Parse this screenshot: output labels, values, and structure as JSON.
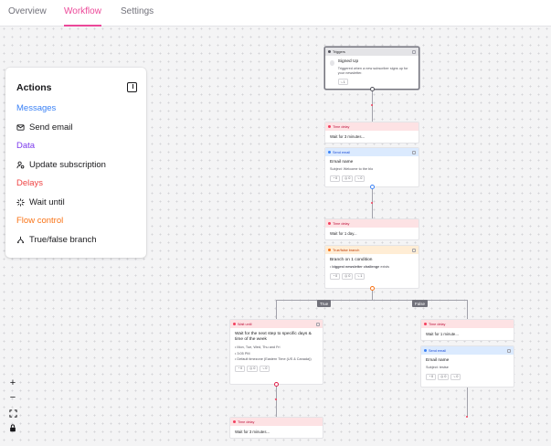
{
  "tabs": {
    "overview": "Overview",
    "workflow": "Workflow",
    "settings": "Settings"
  },
  "actions": {
    "title": "Actions",
    "sections": {
      "messages": "Messages",
      "data": "Data",
      "delays": "Delays",
      "flow_control": "Flow control"
    },
    "items": {
      "send_email": "Send email",
      "update_subscription": "Update subscription",
      "wait_until": "Wait until",
      "true_false_branch": "True/false branch"
    }
  },
  "colors": {
    "messages": "#3b82f6",
    "data": "#7c3aed",
    "delays": "#ef4444",
    "flow_control": "#f97316",
    "active_tab": "#ec4899"
  },
  "nodes": {
    "trigger": {
      "head": "Triggers",
      "title": "Signed Up",
      "sub": "Triggered when a new subscriber signs up for your newsletter.",
      "stat": "1"
    },
    "delay1": {
      "head": "Time delay",
      "body": "Wait for 3 minutes..."
    },
    "email1": {
      "head": "Send email",
      "title": "Email name",
      "sub": "Subject: Welcome to the blo",
      "stats": [
        "0",
        "0",
        "0"
      ]
    },
    "delay2": {
      "head": "Time delay",
      "body": "Wait for 1 day..."
    },
    "branch": {
      "head": "True/false branch",
      "title": "Branch on 1 condition",
      "condition_bold": "biggest newsletter challenge",
      "condition_rest": "exists",
      "stats": [
        "0",
        "0",
        "1"
      ]
    },
    "wait": {
      "head": "Wait until",
      "title": "Wait for the next step to specific days & time of the week",
      "bullets": [
        "Mon, Tue, Wed, Thu and Fri",
        "3:05 PM",
        "Default timezone (Eastern Time (US & Canada))"
      ],
      "stats": [
        "0",
        "0",
        "0"
      ]
    },
    "delay3": {
      "head": "Time delay",
      "body": "Wait for 3 minutes..."
    },
    "delay4": {
      "head": "Time delay",
      "body": "Wait for 1 minute..."
    },
    "email2": {
      "head": "Send email",
      "title": "Email name",
      "sub": "Subject: testse",
      "stats": [
        "0",
        "0",
        "0"
      ]
    }
  },
  "branch_labels": {
    "true": "True",
    "false": "False"
  },
  "zoom": {
    "in": "+",
    "out": "−"
  }
}
